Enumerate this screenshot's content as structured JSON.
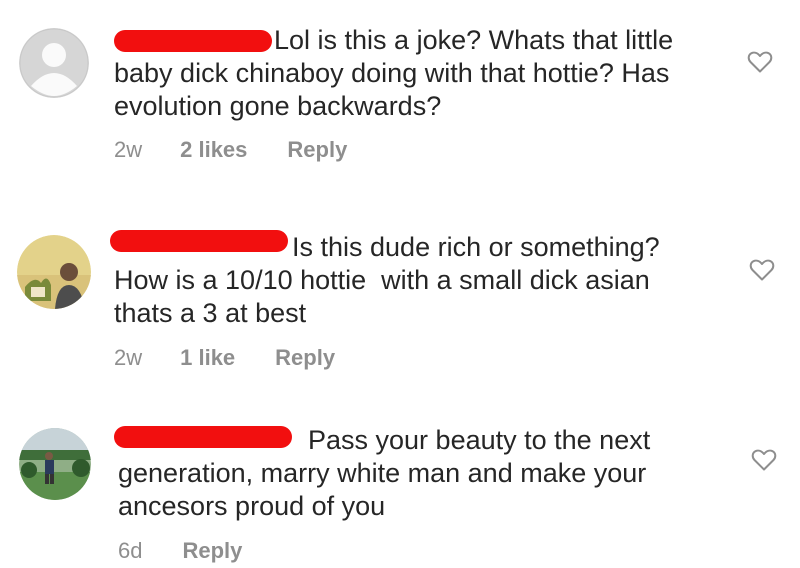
{
  "comments": [
    {
      "text_line1": "Lol is this a joke? Whats that little",
      "text_line2": "baby dick chinaboy doing with that hottie? Has",
      "text_line3": "evolution gone backwards?",
      "time": "2w",
      "likes": "2 likes",
      "reply": "Reply",
      "avatar": "default-avatar-icon"
    },
    {
      "text_line1": "Is this dude rich or something?",
      "text_line2": "How is a 10/10 hottie  with a small dick asian",
      "text_line3": "thats a 3 at best",
      "time": "2w",
      "likes": "1 like",
      "reply": "Reply",
      "avatar": "user-photo-avatar"
    },
    {
      "text_line1": "Pass your beauty to the next",
      "text_line2": "generation, marry white man and make your",
      "text_line3": "ancesors proud of you",
      "time": "6d",
      "likes": "",
      "reply": "Reply",
      "avatar": "user-photo-avatar"
    }
  ],
  "colors": {
    "text": "#262626",
    "meta": "#8e8e8e",
    "redaction": "#f20f0f",
    "heart_outline": "#8e8e8e"
  }
}
